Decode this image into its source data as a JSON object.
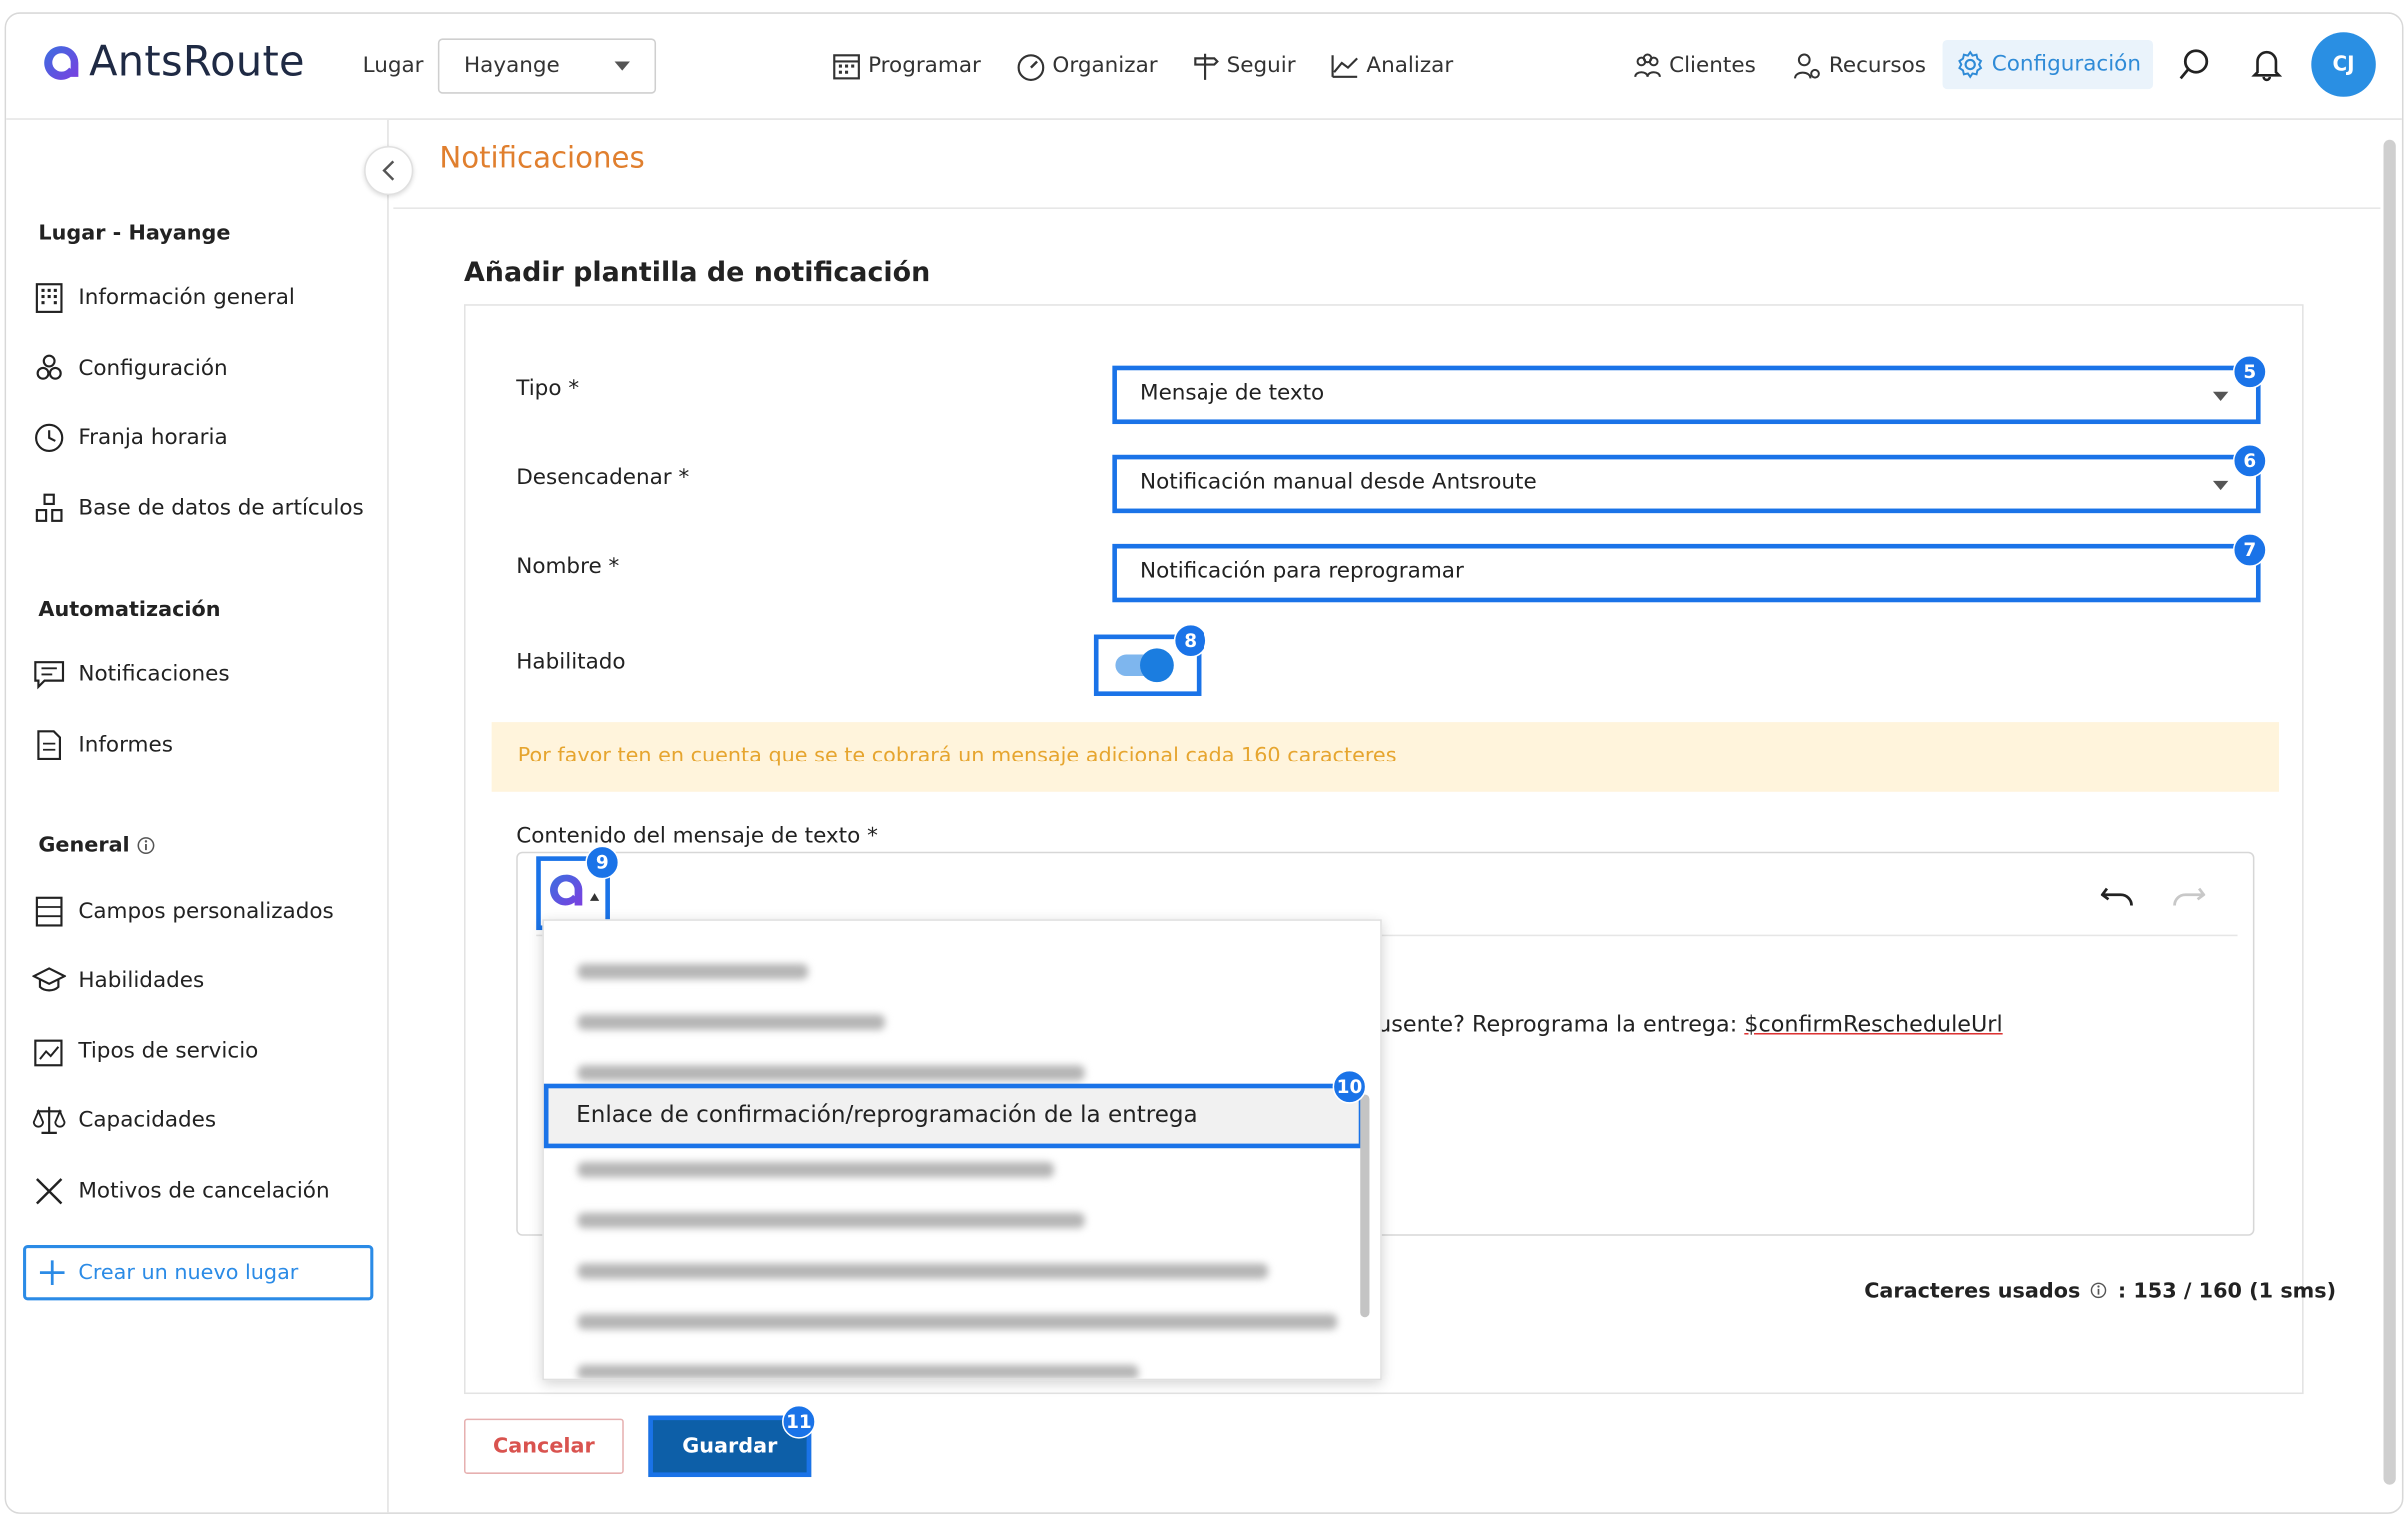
{
  "app": {
    "logo_text": "AntsRoute"
  },
  "header": {
    "lugar_label": "Lugar",
    "lugar_value": "Hayange",
    "nav": {
      "programar": "Programar",
      "organizar": "Organizar",
      "seguir": "Seguir",
      "analizar": "Analizar",
      "clientes": "Clientes",
      "recursos": "Recursos",
      "configuracion": "Configuración"
    },
    "avatar_initials": "CJ"
  },
  "sidebar": {
    "section_place": "Lugar - Hayange",
    "items_place": [
      "Información general",
      "Configuración",
      "Franja horaria",
      "Base de datos de artículos"
    ],
    "section_auto": "Automatización",
    "items_auto": [
      "Notificaciones",
      "Informes"
    ],
    "section_general": "General",
    "items_general": [
      "Campos personalizados",
      "Habilidades",
      "Tipos de servicio",
      "Capacidades",
      "Motivos de cancelación"
    ],
    "new_place": "Crear un nuevo lugar"
  },
  "page": {
    "title": "Notificaciones",
    "form_title": "Añadir plantilla de notificación"
  },
  "form": {
    "tipo_label": "Tipo *",
    "tipo_value": "Mensaje de texto",
    "trigger_label": "Desencadenar *",
    "trigger_value": "Notificación manual desde Antsroute",
    "name_label": "Nombre *",
    "name_value": "Notificación para reprogramar",
    "enabled_label": "Habilitado",
    "enabled": true,
    "warning": "Por favor ten en cuenta que se te cobrará un mensaje adicional cada 160 caracteres",
    "content_label": "Contenido del mensaje de texto *",
    "content_visible_prefix": "usente? Reprograma la entrega: ",
    "content_variable": "$confirmRescheduleUrl",
    "chars_label": "Caracteres usados",
    "chars_value": ": 153 / 160 (1 sms)"
  },
  "dropdown": {
    "selected": "Enlace de confirmación/reprogramación de la entrega"
  },
  "buttons": {
    "cancel": "Cancelar",
    "save": "Guardar"
  },
  "badges": [
    "5",
    "6",
    "7",
    "8",
    "9",
    "10",
    "11"
  ],
  "colors": {
    "accent": "#1a73e8",
    "brand_blue": "#2a8fe3",
    "title_orange": "#e07f2e",
    "warning_bg": "#fff4dc",
    "warning_text": "#e6a52f",
    "save_bg": "#0d5fa8",
    "cancel_text": "#d9534f"
  }
}
